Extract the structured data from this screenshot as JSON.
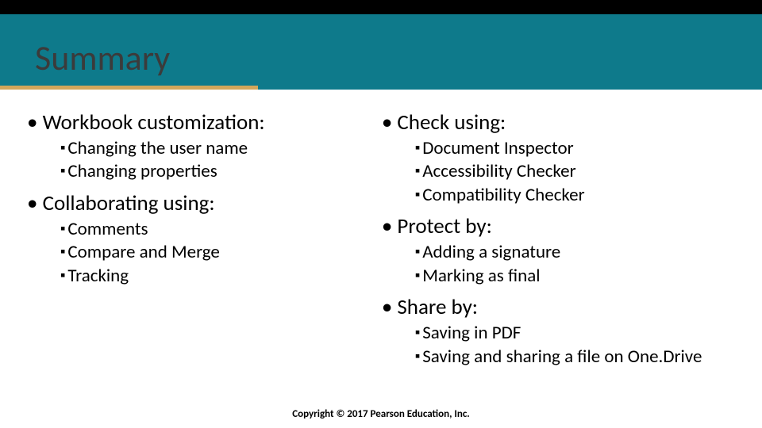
{
  "title": "Summary",
  "left": {
    "h1": "Workbook customization:",
    "i1": "Changing the user name",
    "i2": "Changing properties",
    "h2": "Collaborating using:",
    "i3": "Comments",
    "i4": "Compare and Merge",
    "i5": "Tracking"
  },
  "right": {
    "h1": "Check using:",
    "i1": "Document Inspector",
    "i2": "Accessibility Checker",
    "i3": "Compatibility Checker",
    "h2": "Protect by:",
    "i4": "Adding a signature",
    "i5": "Marking as final",
    "h3": "Share by:",
    "i6": "Saving in PDF",
    "i7": "Saving and sharing a file on One.Drive"
  },
  "copyright": "Copyright © 2017 Pearson Education, Inc."
}
